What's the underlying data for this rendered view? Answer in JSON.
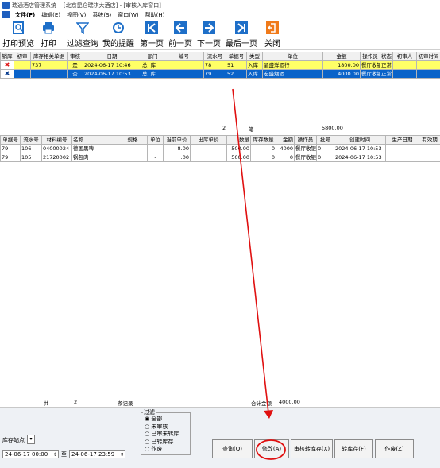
{
  "window": {
    "app_name": "瑞通酒店管理系统",
    "hotel": "[北京昆仑瑞祺大酒店]",
    "window_name": "[审核入库窗口]"
  },
  "menu": [
    "文件(F)",
    "编辑(E)",
    "视图(V)",
    "系统(S)",
    "窗口(W)",
    "帮助(H)"
  ],
  "toolbar": [
    {
      "label": "打印预览",
      "icon": "print-preview-icon"
    },
    {
      "label": "打印",
      "icon": "printer-icon"
    },
    {
      "label": "过滤查询",
      "icon": "filter-icon"
    },
    {
      "label": "我的提醒",
      "icon": "clock-icon"
    },
    {
      "label": "第一页",
      "icon": "first-page-icon"
    },
    {
      "label": "前一页",
      "icon": "arrow-left-icon"
    },
    {
      "label": "下一页",
      "icon": "arrow-right-icon"
    },
    {
      "label": "最后一页",
      "icon": "last-page-icon"
    },
    {
      "label": "关闭",
      "icon": "exit-icon"
    }
  ],
  "top_table": {
    "headers": [
      "销库",
      "初审",
      "库存相关单据",
      "审核",
      "日期",
      "部门",
      "编号",
      "流水号",
      "单据号",
      "类型",
      "单位",
      "金额",
      "操作员",
      "状态",
      "初审人",
      "初审时间"
    ],
    "rows": [
      [
        "✖",
        "",
        "737",
        "是",
        "2024-06-17 10:46",
        "总",
        "库",
        "78",
        "51",
        "入库",
        "晶盛洋酒行",
        "1800.00",
        "餐厅收银",
        "正常",
        "",
        ""
      ],
      [
        "✖",
        "",
        "",
        "否",
        "2024-06-17 10:53",
        "总",
        "库",
        "79",
        "52",
        "入库",
        "宏盛烟酒",
        "4000.00",
        "餐厅收银",
        "正常",
        "",
        ""
      ]
    ],
    "summary": {
      "count": "2",
      "unit": "笔",
      "amount": "5800.00"
    }
  },
  "bottom_table": {
    "headers": [
      "单据号",
      "流水号",
      "材料编号",
      "名称",
      "规格",
      "单位",
      "当前单价",
      "出库单价",
      "数量",
      "库存数量",
      "金额",
      "操作员",
      "批号",
      "创建时间",
      "生产日期",
      "有效期"
    ],
    "rows": [
      [
        "79",
        "106",
        "04000024",
        "德国黑啤",
        "",
        "-",
        "8.00",
        "",
        "500.00",
        "0",
        "4000",
        "餐厅收银",
        "0",
        "2024-06-17 10:53",
        "",
        ""
      ],
      [
        "79",
        "105",
        "21720002",
        "锅包肉",
        "",
        "-",
        ".00",
        "",
        "500.00",
        "0",
        "0",
        "餐厅收银",
        "0",
        "2024-06-17 10:53",
        "",
        ""
      ]
    ],
    "footer": {
      "total_label": "共",
      "count": "2",
      "records_label": "条记录",
      "sum_label": "合计金额",
      "sum_value": "4000.00"
    }
  },
  "filter": {
    "title": "过滤",
    "options": [
      "全部",
      "未审核",
      "已审未转库",
      "已转库存",
      "作废"
    ],
    "selected": 0
  },
  "station": {
    "label": "库存站点"
  },
  "dates": {
    "from": "24-06-17 00:00",
    "to_label": "至",
    "to": "24-06-17 23:59"
  },
  "buttons": [
    "查询(Q)",
    "修改(A)",
    "审核转库存(X)",
    "转库存(F)",
    "作废(Z)"
  ],
  "colors": {
    "highlight_row": "#ffff66",
    "selected_row": "#0a63c9",
    "annotation": "#e01010"
  }
}
